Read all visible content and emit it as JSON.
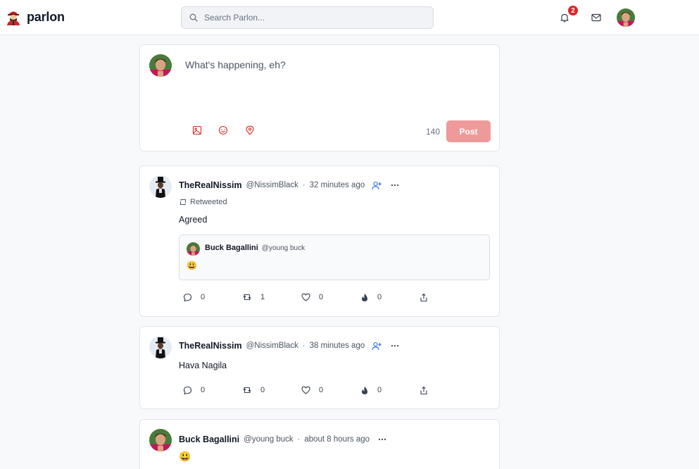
{
  "header": {
    "brand": "parlon",
    "search_placeholder": "Search Parlon...",
    "notification_count": "2",
    "icons": [
      "parlon-logo-icon",
      "search-icon",
      "bell-icon",
      "mail-icon"
    ]
  },
  "composer": {
    "placeholder": "What's happening, eh?",
    "char_count": "140",
    "post_label": "Post",
    "tools": [
      "image-icon",
      "smiley-icon",
      "location-pin-icon"
    ]
  },
  "posts": [
    {
      "name": "TheRealNissim",
      "handle": "@NissimBlack",
      "time": "32 minutes ago",
      "retweet_label": "Retweeted",
      "text": "Agreed",
      "quote": {
        "name": "Buck Bagallini",
        "handle": "@young buck",
        "text": "😃"
      },
      "counts": {
        "replies": "0",
        "retweets": "1",
        "likes": "0",
        "upvotes": "0"
      }
    },
    {
      "name": "TheRealNissim",
      "handle": "@NissimBlack",
      "time": "38 minutes ago",
      "text": "Hava Nagila",
      "counts": {
        "replies": "0",
        "retweets": "0",
        "likes": "0",
        "upvotes": "0"
      }
    },
    {
      "name": "Buck Bagallini",
      "handle": "@young buck",
      "time": "about 8 hours ago",
      "text": "😃"
    }
  ],
  "colors": {
    "accent": "#dc2626",
    "post_button": "#ef9a9a",
    "follow": "#2563eb"
  }
}
